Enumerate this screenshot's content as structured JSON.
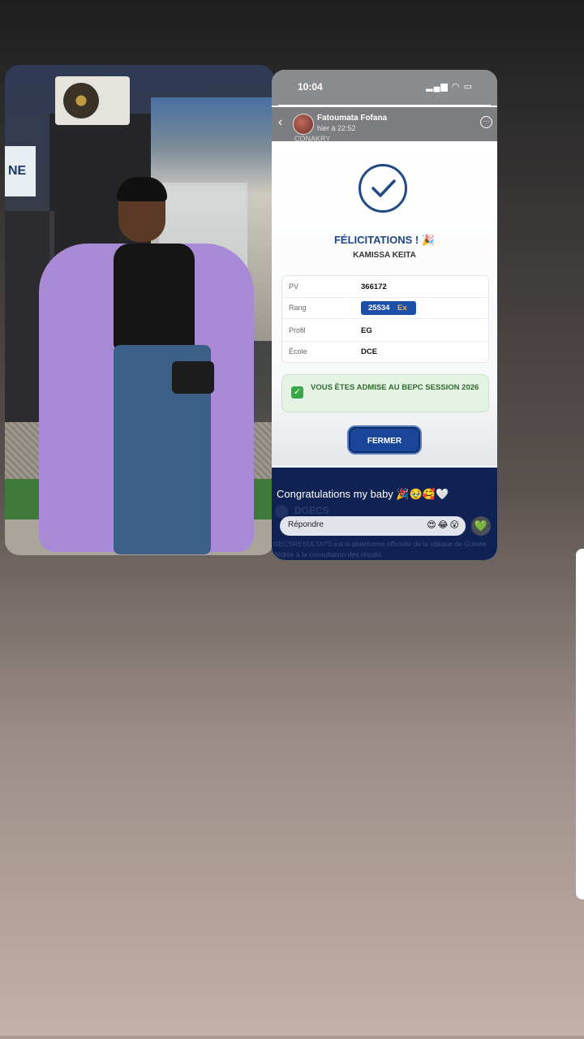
{
  "status_bar": {
    "time": "10:04",
    "icons": "▂▄▆ ◠ ▭"
  },
  "story": {
    "author": "Fatoumata Fofana",
    "posted": "hier à 22:52",
    "ghost_location": "CONAKRY",
    "caption": "Congratulations my baby 🎉🥹🥰🤍",
    "reply_placeholder": "Répondre",
    "reactions": "😍😂😮",
    "heart": "💚"
  },
  "result_card": {
    "title": "FÉLICITATIONS ! 🎉",
    "student_name": "KAMISSA KEITA",
    "rows": [
      {
        "label": "PV",
        "value": "366172"
      },
      {
        "label": "Rang",
        "value": "25534",
        "badge": "Ex"
      },
      {
        "label": "Profil",
        "value": "EG"
      },
      {
        "label": "École",
        "value": "DCE"
      }
    ],
    "admission_message": "VOUS ÊTES ADMISE AU BEPC SESSION 2026",
    "close_button": "FERMER"
  },
  "ghost_footer": {
    "brand": "DGECS",
    "description": "GECSRESULTATS est la plateforme officielle de la ublique de Guinée dédiée à la consultation des résulta"
  },
  "photo_sign_text": "NE",
  "colors": {
    "accent_blue": "#1d4486",
    "rank_badge": "#1c4fa8",
    "success_green": "#37a845",
    "footer_navy": "#0f2253"
  }
}
